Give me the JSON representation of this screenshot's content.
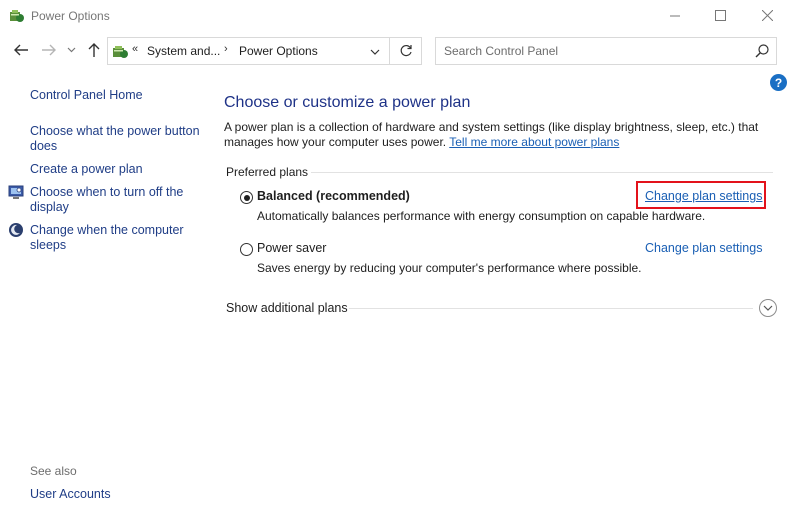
{
  "window": {
    "title": "Power Options",
    "icon": "power-options-icon"
  },
  "nav": {
    "breadcrumb_prefix": "«",
    "breadcrumb": [
      "System and...",
      "Power Options"
    ],
    "breadcrumb_separator": "›",
    "search_placeholder": "Search Control Panel"
  },
  "sidebar": {
    "home": "Control Panel Home",
    "items": [
      {
        "label": "Choose what the power button does",
        "icon": ""
      },
      {
        "label": "Create a power plan",
        "icon": ""
      },
      {
        "label": "Choose when to turn off the display",
        "icon": "display-icon"
      },
      {
        "label": "Change when the computer sleeps",
        "icon": "moon-icon"
      }
    ],
    "see_also": "See also",
    "see_also_links": [
      "User Accounts"
    ]
  },
  "main": {
    "title": "Choose or customize a power plan",
    "description": "A power plan is a collection of hardware and system settings (like display brightness, sleep, etc.) that manages how your computer uses power.",
    "learn_more": "Tell me more about power plans",
    "preferred_plans_header": "Preferred plans",
    "plans": [
      {
        "name": "Balanced (recommended)",
        "description": "Automatically balances performance with energy consumption on capable hardware.",
        "selected": true,
        "link": "Change plan settings"
      },
      {
        "name": "Power saver",
        "description": "Saves energy by reducing your computer's performance where possible.",
        "selected": false,
        "link": "Change plan settings"
      }
    ],
    "show_additional": "Show additional plans"
  },
  "colors": {
    "link": "#1a5fb4",
    "sidebar_link": "#1f3d86",
    "title": "#1e3287",
    "highlight": "#e3121b"
  }
}
